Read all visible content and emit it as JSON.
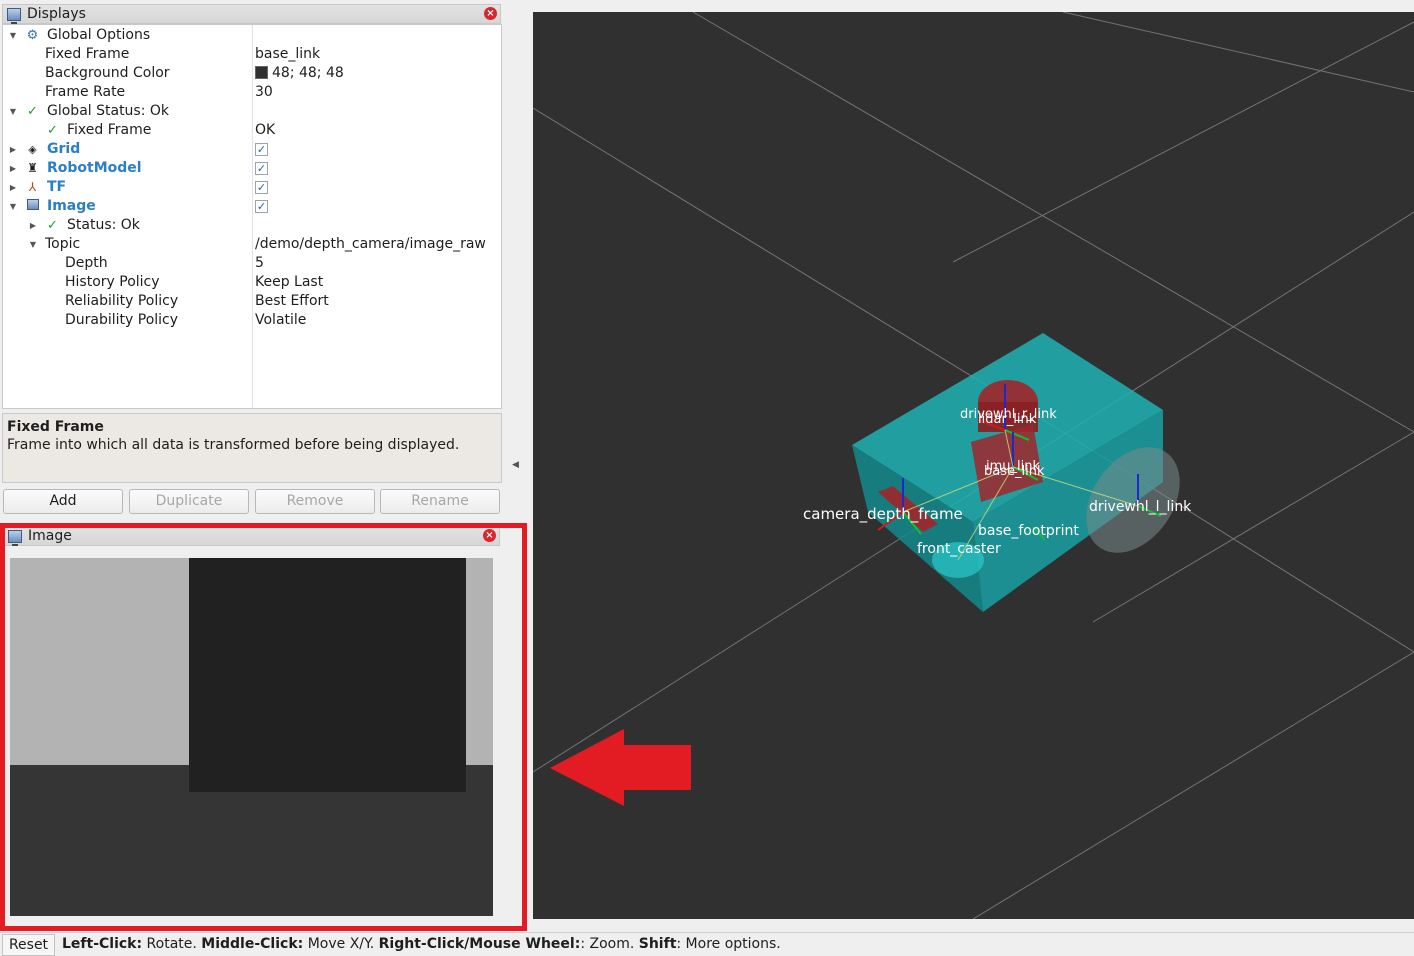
{
  "displays_panel": {
    "title": "Displays",
    "rows": [
      {
        "label": "Global Options",
        "value": "",
        "icon": "gear-icon"
      },
      {
        "label": "Fixed Frame",
        "value": "base_link"
      },
      {
        "label": "Background Color",
        "value": "48; 48; 48",
        "swatch_color": "#303030"
      },
      {
        "label": "Frame Rate",
        "value": "30"
      },
      {
        "label": "Global Status: Ok",
        "value": "",
        "icon": "check-icon"
      },
      {
        "label": "Fixed Frame",
        "value": "OK",
        "icon": "check-icon"
      },
      {
        "label": "Grid",
        "value": "",
        "checked": true,
        "icon": "grid-icon"
      },
      {
        "label": "RobotModel",
        "value": "",
        "checked": true,
        "icon": "robot-icon"
      },
      {
        "label": "TF",
        "value": "",
        "checked": true,
        "icon": "axes-icon"
      },
      {
        "label": "Image",
        "value": "",
        "checked": true,
        "icon": "image-icon"
      },
      {
        "label": "Status: Ok",
        "value": "",
        "icon": "check-icon"
      },
      {
        "label": "Topic",
        "value": "/demo/depth_camera/image_raw"
      },
      {
        "label": "Depth",
        "value": "5"
      },
      {
        "label": "History Policy",
        "value": "Keep Last"
      },
      {
        "label": "Reliability Policy",
        "value": "Best Effort"
      },
      {
        "label": "Durability Policy",
        "value": "Volatile"
      }
    ]
  },
  "description": {
    "title": "Fixed Frame",
    "text": "Frame into which all data is transformed before being displayed."
  },
  "buttons": {
    "add": "Add",
    "duplicate": "Duplicate",
    "remove": "Remove",
    "rename": "Rename"
  },
  "image_panel": {
    "title": "Image"
  },
  "view3d": {
    "background": "#303030",
    "frame_labels": [
      "drivewhl_r_link",
      "lidar_link",
      "imu_link",
      "base_link",
      "drivewhl_l_link",
      "camera_depth_frame",
      "base_footprint",
      "front_caster"
    ]
  },
  "statusbar": {
    "reset": "Reset",
    "help_parts": [
      {
        "bold": "Left-Click:",
        "text": " Rotate. "
      },
      {
        "bold": "Middle-Click:",
        "text": " Move X/Y. "
      },
      {
        "bold": "Right-Click/Mouse Wheel:",
        "text": ": Zoom. "
      },
      {
        "bold": "Shift",
        "text": ": More options."
      }
    ]
  },
  "colors": {
    "highlight": "#e31c24",
    "robot_body": "#1aa5a8",
    "link_red": "#a0262a"
  }
}
